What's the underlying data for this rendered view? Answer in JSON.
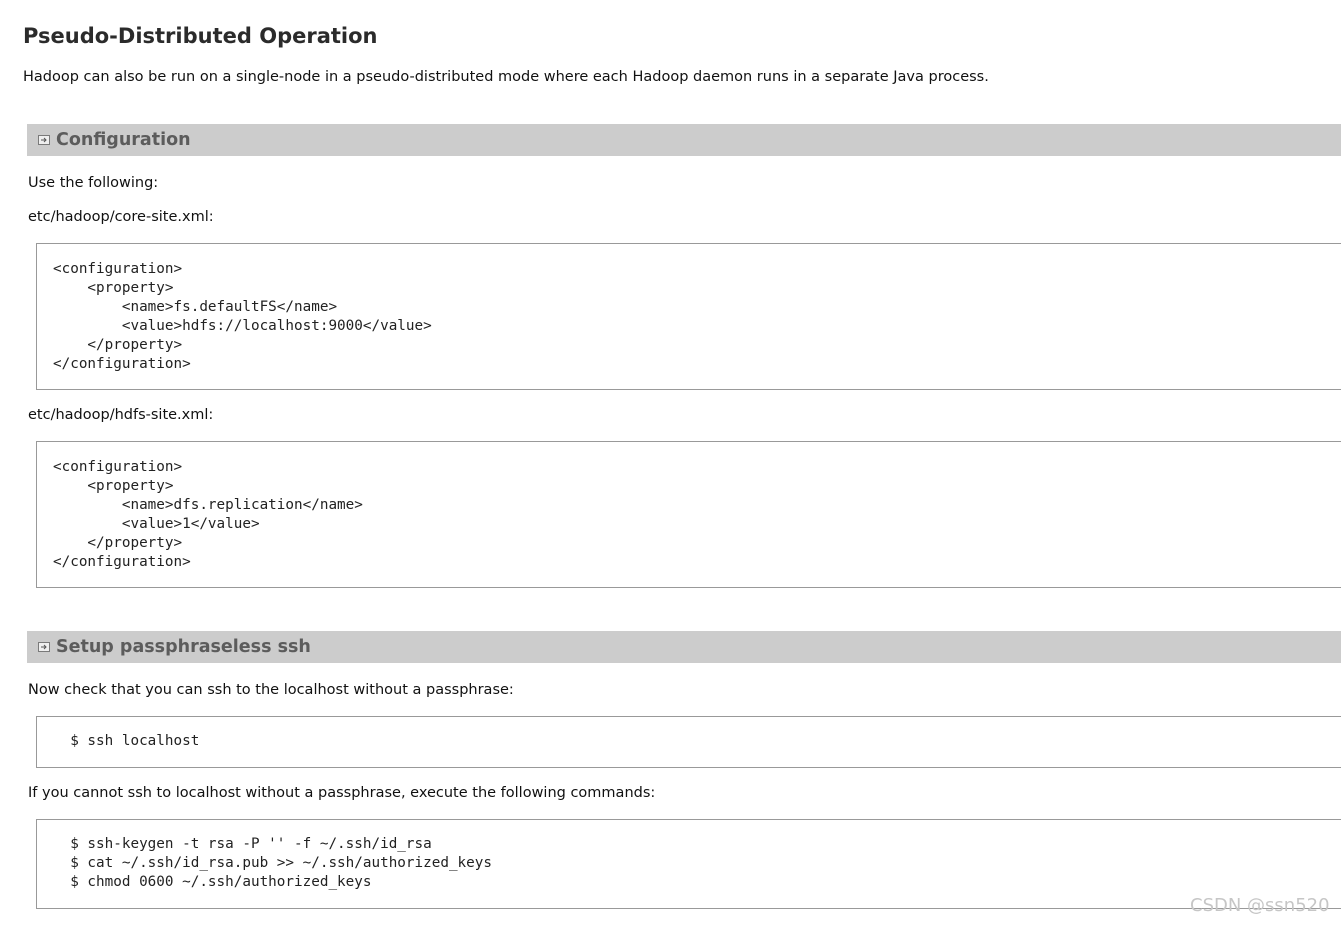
{
  "page": {
    "title": "Pseudo-Distributed Operation",
    "intro": "Hadoop can also be run on a single-node in a pseudo-distributed mode where each Hadoop daemon runs in a separate Java process."
  },
  "configuration": {
    "header": "Configuration",
    "icon": "expand-icon",
    "use_following": "Use the following:",
    "core_site_label": "etc/hadoop/core-site.xml:",
    "core_site_code": "<configuration>\n    <property>\n        <name>fs.defaultFS</name>\n        <value>hdfs://localhost:9000</value>\n    </property>\n</configuration>",
    "hdfs_site_label": "etc/hadoop/hdfs-site.xml:",
    "hdfs_site_code": "<configuration>\n    <property>\n        <name>dfs.replication</name>\n        <value>1</value>\n    </property>\n</configuration>"
  },
  "ssh": {
    "header": "Setup passphraseless ssh",
    "icon": "expand-icon",
    "check_text": "Now check that you can ssh to the localhost without a passphrase:",
    "check_code": "  $ ssh localhost",
    "fallback_text": "If you cannot ssh to localhost without a passphrase, execute the following commands:",
    "fallback_code": "  $ ssh-keygen -t rsa -P '' -f ~/.ssh/id_rsa\n  $ cat ~/.ssh/id_rsa.pub >> ~/.ssh/authorized_keys\n  $ chmod 0600 ~/.ssh/authorized_keys"
  },
  "watermark": "CSDN @ssn520",
  "colors": {
    "section_header_bg": "#cccccc",
    "section_title": "#5c5c5c",
    "code_border": "#999999"
  }
}
